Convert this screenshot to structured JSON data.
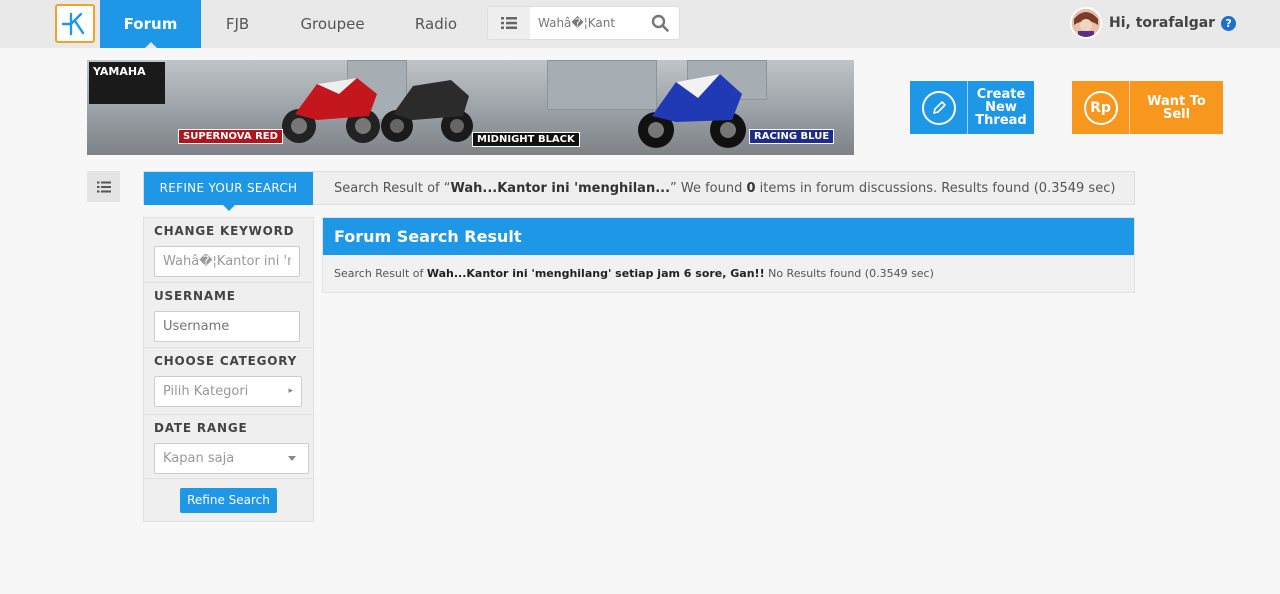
{
  "nav": {
    "items": [
      "Forum",
      "FJB",
      "Groupee",
      "Radio"
    ],
    "active": "Forum",
    "search_value": "Wahâ�¦Kant"
  },
  "user": {
    "greeting": "Hi, torafalgar",
    "help": "?"
  },
  "banner": {
    "brand": "YAMAHA",
    "tags": [
      "SUPERNOVA RED",
      "MIDNIGHT BLACK",
      "RACING BLUE"
    ]
  },
  "cta": {
    "create_label": "Create New Thread",
    "sell_label": "Want To Sell",
    "sell_icon_text": "Rp"
  },
  "result_bar": {
    "tab_label": "REFINE YOUR SEARCH",
    "prefix": "Search Result of “",
    "query": "Wah...Kantor ini 'menghilan...",
    "middle": "” We found ",
    "count": "0",
    "suffix": " items in forum discussions. Results found (0.3549 sec)"
  },
  "refine": {
    "keyword_label": "CHANGE KEYWORD",
    "keyword_value": "Wahâ�¦Kantor ini 'm",
    "username_label": "USERNAME",
    "username_placeholder": "Username",
    "category_label": "CHOOSE CATEGORY",
    "category_value": "Pilih Kategori",
    "date_label": "DATE RANGE",
    "date_value": "Kapan saja",
    "button_label": "Refine Search"
  },
  "results": {
    "title": "Forum Search Result",
    "prefix": "Search Result of ",
    "query": "Wah...Kantor ini 'menghilang' setiap jam 6 sore, Gan!!",
    "suffix": " No Results found (0.3549 sec)"
  },
  "colors": {
    "primary": "#1e98e6",
    "accent": "#f7971e",
    "logo_border": "#f5a02a"
  }
}
